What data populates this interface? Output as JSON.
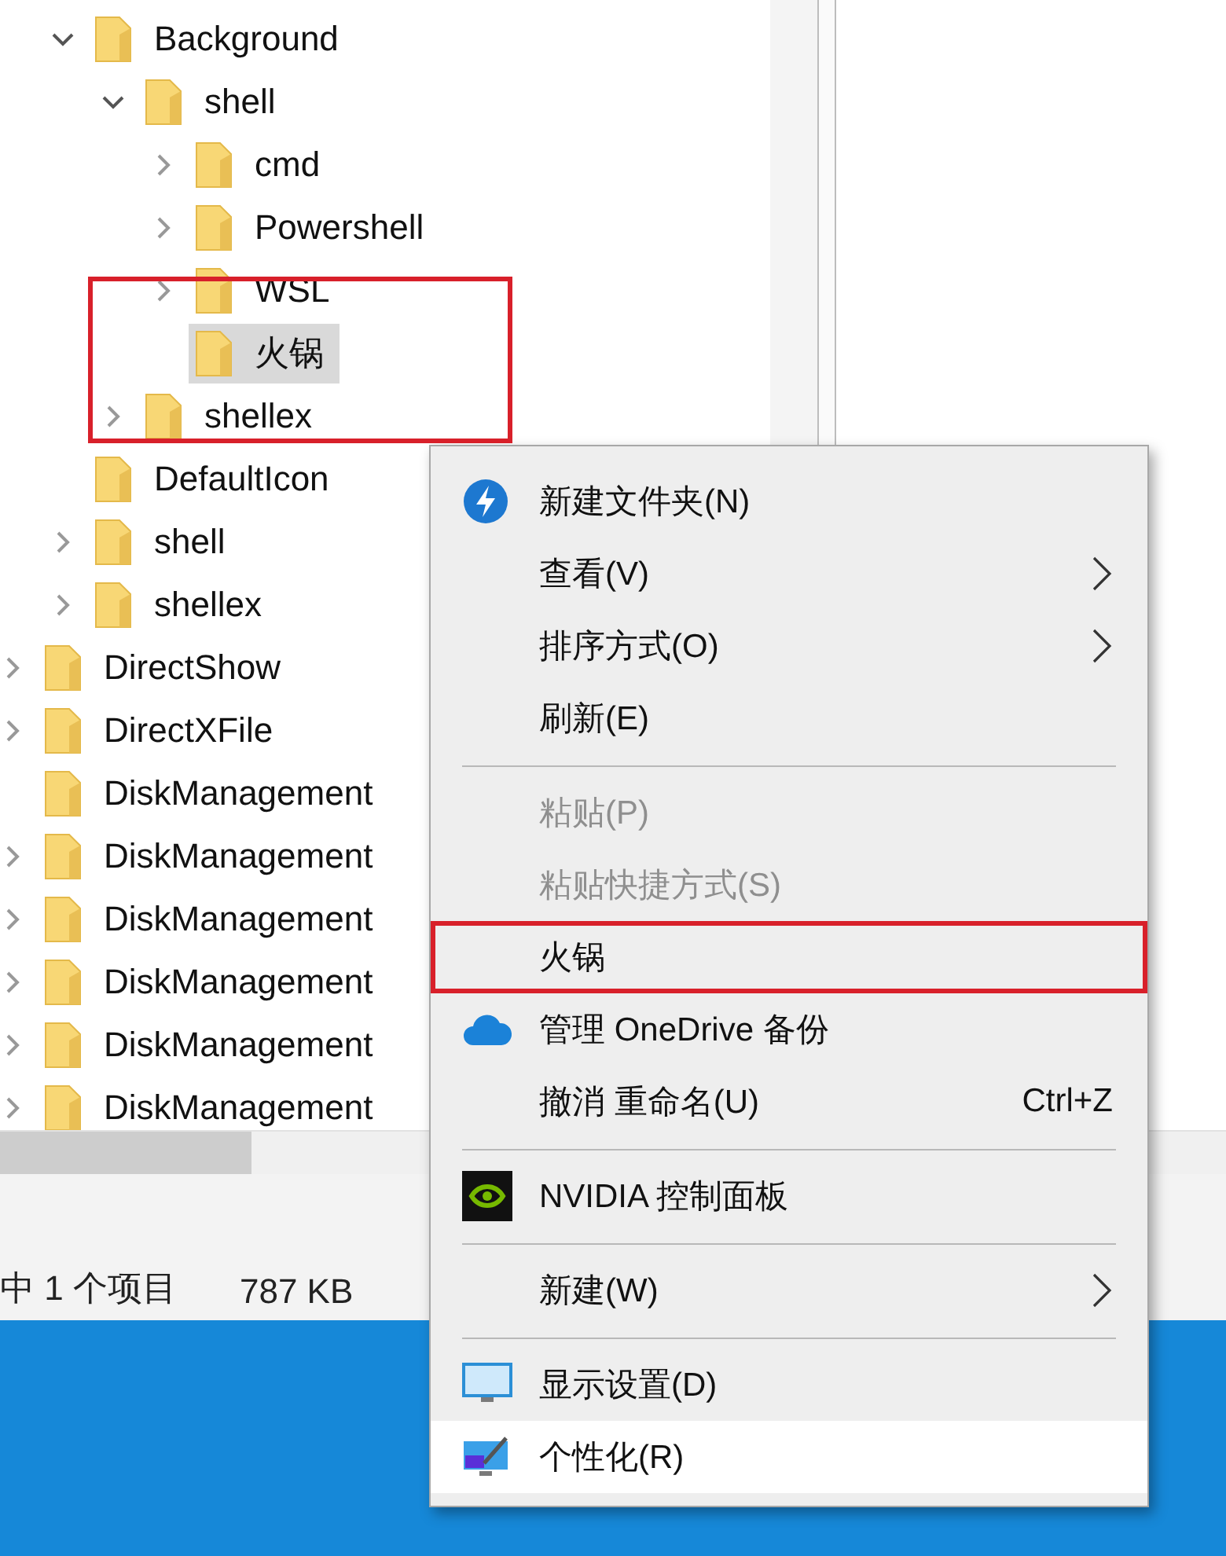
{
  "tree": {
    "partial_branch": [
      {
        "label": "Background",
        "expanded": true,
        "selected": false,
        "children": [
          {
            "label": "shell",
            "expanded": true,
            "selected": false,
            "children": [
              {
                "label": "cmd",
                "expanded": false,
                "selected": false
              },
              {
                "label": "Powershell",
                "expanded": false,
                "selected": false
              },
              {
                "label": "WSL",
                "expanded": false,
                "selected": false
              },
              {
                "label": "火锅",
                "selected": true
              }
            ]
          },
          {
            "label": "shellex",
            "expanded": false,
            "selected": false
          }
        ]
      },
      {
        "label": "DefaultIcon",
        "selected": false
      },
      {
        "label": "shell",
        "expanded": false,
        "selected": false
      },
      {
        "label": "shellex",
        "expanded": false,
        "selected": false
      }
    ],
    "items": [
      {
        "label": "DirectShow",
        "expanded": false,
        "selected": false
      },
      {
        "label": "DirectXFile",
        "expanded": false,
        "selected": false
      },
      {
        "label": "DiskManagement",
        "selected": false
      },
      {
        "label": "DiskManagement",
        "expanded": false,
        "selected": false
      },
      {
        "label": "DiskManagement",
        "expanded": false,
        "selected": false
      },
      {
        "label": "DiskManagement",
        "expanded": false,
        "selected": false
      },
      {
        "label": "DiskManagement",
        "expanded": false,
        "selected": false
      },
      {
        "label": "DiskManagement",
        "expanded": false,
        "selected": false
      }
    ]
  },
  "status_bar": {
    "selection": "中 1 个项目",
    "size": "787 KB"
  },
  "context_menu": {
    "items": [
      {
        "kind": "item",
        "label": "新建文件夹(N)",
        "disabled": false,
        "submenu": false,
        "highlighted": false,
        "annotated": false
      },
      {
        "kind": "item",
        "label": "查看(V)",
        "disabled": false,
        "submenu": true,
        "highlighted": false,
        "annotated": false
      },
      {
        "kind": "item",
        "label": "排序方式(O)",
        "disabled": false,
        "submenu": true,
        "highlighted": false,
        "annotated": false
      },
      {
        "kind": "item",
        "label": "刷新(E)",
        "disabled": false,
        "submenu": false,
        "highlighted": false,
        "annotated": false
      },
      {
        "kind": "separator"
      },
      {
        "kind": "item",
        "label": "粘贴(P)",
        "disabled": true,
        "submenu": false,
        "highlighted": false,
        "annotated": false
      },
      {
        "kind": "item",
        "label": "粘贴快捷方式(S)",
        "disabled": true,
        "submenu": false,
        "highlighted": false,
        "annotated": false
      },
      {
        "kind": "item",
        "label": "火锅",
        "disabled": false,
        "submenu": false,
        "highlighted": false,
        "annotated": true
      },
      {
        "kind": "item",
        "label": "管理 OneDrive 备份",
        "disabled": false,
        "submenu": false,
        "highlighted": false,
        "annotated": false
      },
      {
        "kind": "item",
        "label": "撤消 重命名(U)",
        "shortcut": "Ctrl+Z",
        "disabled": false,
        "submenu": false,
        "highlighted": false,
        "annotated": false
      },
      {
        "kind": "separator"
      },
      {
        "kind": "item",
        "label": "NVIDIA 控制面板",
        "disabled": false,
        "submenu": false,
        "highlighted": false,
        "annotated": false
      },
      {
        "kind": "separator"
      },
      {
        "kind": "item",
        "label": "新建(W)",
        "disabled": false,
        "submenu": true,
        "highlighted": false,
        "annotated": false
      },
      {
        "kind": "separator"
      },
      {
        "kind": "item",
        "label": "显示设置(D)",
        "disabled": false,
        "submenu": false,
        "highlighted": false,
        "annotated": false
      },
      {
        "kind": "item",
        "label": "个性化(R)",
        "disabled": false,
        "submenu": false,
        "highlighted": true,
        "annotated": false
      }
    ]
  }
}
